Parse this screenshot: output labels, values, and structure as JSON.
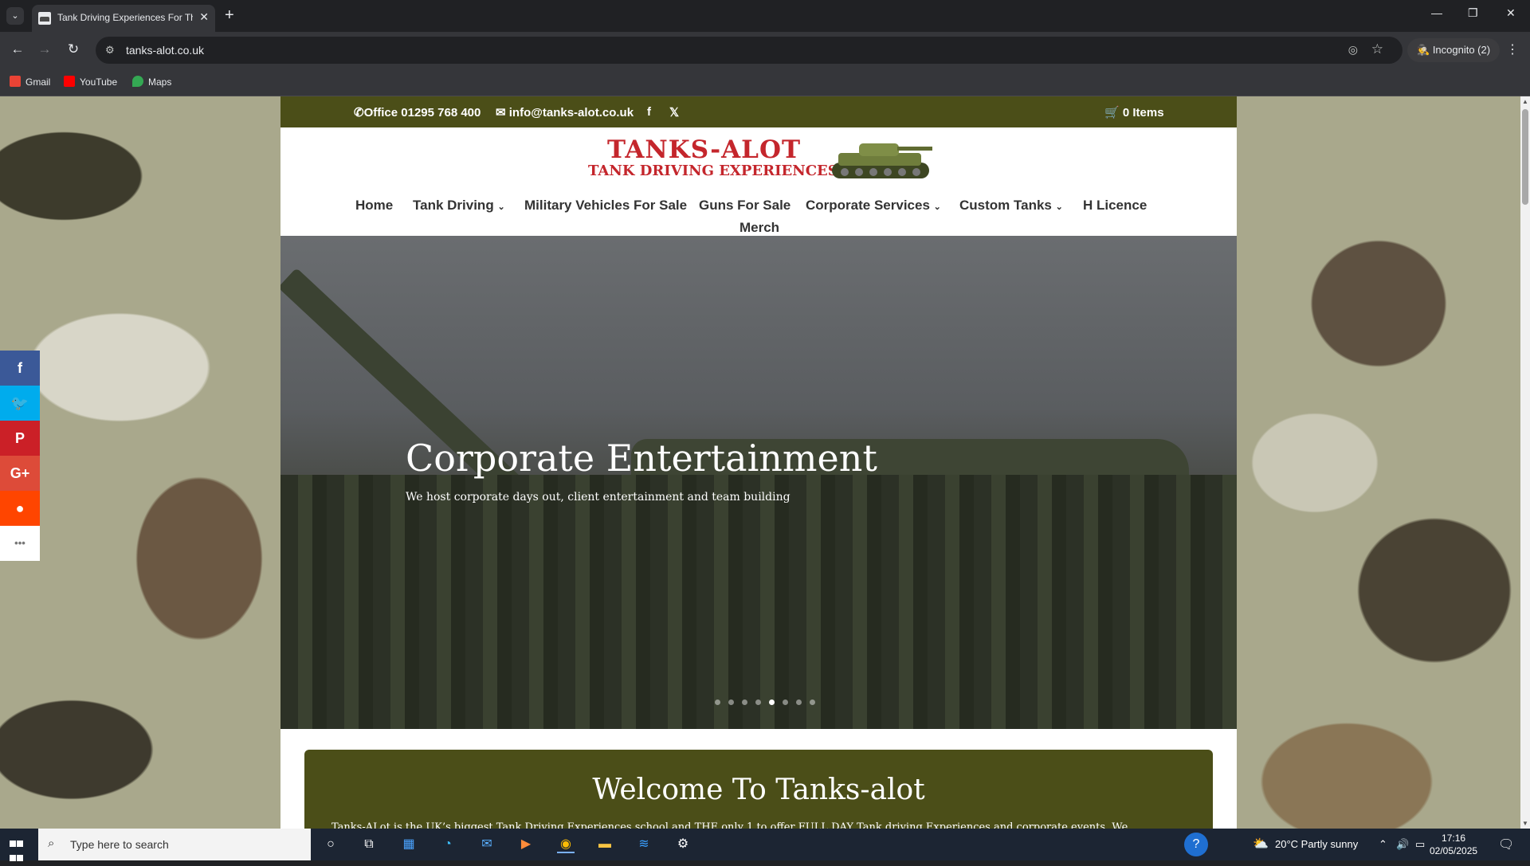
{
  "browser": {
    "tab_title": "Tank Driving Experiences For Th",
    "url": "tanks-alot.co.uk",
    "incognito_label": "Incognito (2)",
    "bookmarks": [
      {
        "label": "Gmail",
        "icon": "gmail-icon",
        "color": "#ea4335"
      },
      {
        "label": "YouTube",
        "icon": "youtube-icon",
        "color": "#ff0000"
      },
      {
        "label": "Maps",
        "icon": "maps-icon",
        "color": "#34a853"
      }
    ]
  },
  "site": {
    "topbar": {
      "phone": "Office 01295 768 400",
      "email": "info@tanks-alot.co.uk",
      "cart": "0 Items"
    },
    "logo": {
      "line1": "TANKS-ALOT",
      "line2": "TANK DRIVING EXPERIENCES"
    },
    "nav": [
      {
        "label": "Home"
      },
      {
        "label": "Tank Driving"
      },
      {
        "label": "Military Vehicles For Sale"
      },
      {
        "label": "Guns For Sale"
      },
      {
        "label": "Corporate Services"
      },
      {
        "label": "Custom Tanks"
      },
      {
        "label": "H Licence"
      },
      {
        "label": "Merch"
      }
    ],
    "hero": {
      "title": "Corporate Entertainment",
      "subtitle": "We host corporate days out, client entertainment and team building",
      "slide_count": 8,
      "active_slide": 5
    },
    "welcome": {
      "title": "Welcome To Tanks-alot",
      "text": "Tanks-ALot is the UK’s biggest Tank Driving Experiences school and THE only 1 to offer FULL DAY Tank driving Experiences and corporate events. We"
    },
    "share_buttons": [
      {
        "icon": "facebook-icon",
        "glyph": "f",
        "color": "#3b5998"
      },
      {
        "icon": "twitter-icon",
        "glyph": "🐦",
        "color": "#00aced"
      },
      {
        "icon": "pinterest-icon",
        "glyph": "P",
        "color": "#cb2027"
      },
      {
        "icon": "google-plus-icon",
        "glyph": "G+",
        "color": "#dd4b39"
      },
      {
        "icon": "reddit-icon",
        "glyph": "●",
        "color": "#ff4500"
      },
      {
        "icon": "more-icon",
        "glyph": "•••",
        "color": "#ffffff"
      }
    ],
    "colors": {
      "brand_green": "#4b4e18",
      "logo_red": "#c4262c"
    }
  },
  "taskbar": {
    "search_placeholder": "Type here to search",
    "weather": "20°C  Partly sunny",
    "time": "17:16",
    "date": "02/05/2025"
  }
}
